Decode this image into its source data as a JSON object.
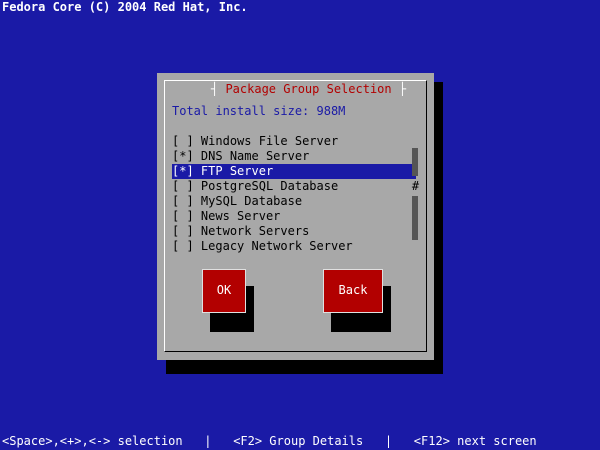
{
  "header": {
    "copyright": "Fedora Core (C) 2004 Red Hat, Inc."
  },
  "dialog": {
    "title": "Package Group Selection",
    "install_size": "Total install size: 988M",
    "items": [
      {
        "checkbox": "[ ]",
        "label": "Windows File Server",
        "selected": false
      },
      {
        "checkbox": "[*]",
        "label": "DNS Name Server",
        "selected": false
      },
      {
        "checkbox": "[*]",
        "label": "FTP Server",
        "selected": true
      },
      {
        "checkbox": "[ ]",
        "label": "PostgreSQL Database",
        "selected": false
      },
      {
        "checkbox": "[ ]",
        "label": "MySQL Database",
        "selected": false
      },
      {
        "checkbox": "[ ]",
        "label": "News Server",
        "selected": false
      },
      {
        "checkbox": "[ ]",
        "label": "Network Servers",
        "selected": false
      },
      {
        "checkbox": "[ ]",
        "label": "Legacy Network Server",
        "selected": false
      }
    ],
    "scroll_thumb": "#",
    "ok_label": "OK",
    "back_label": "Back"
  },
  "footer": {
    "help": "<Space>,<+>,<-> selection   |   <F2> Group Details   |   <F12> next screen"
  },
  "colors": {
    "background": "#1a1aa6",
    "dialog_bg": "#a8a8a8",
    "accent_red": "#b20000",
    "selection_bg": "#1a1aa6"
  }
}
